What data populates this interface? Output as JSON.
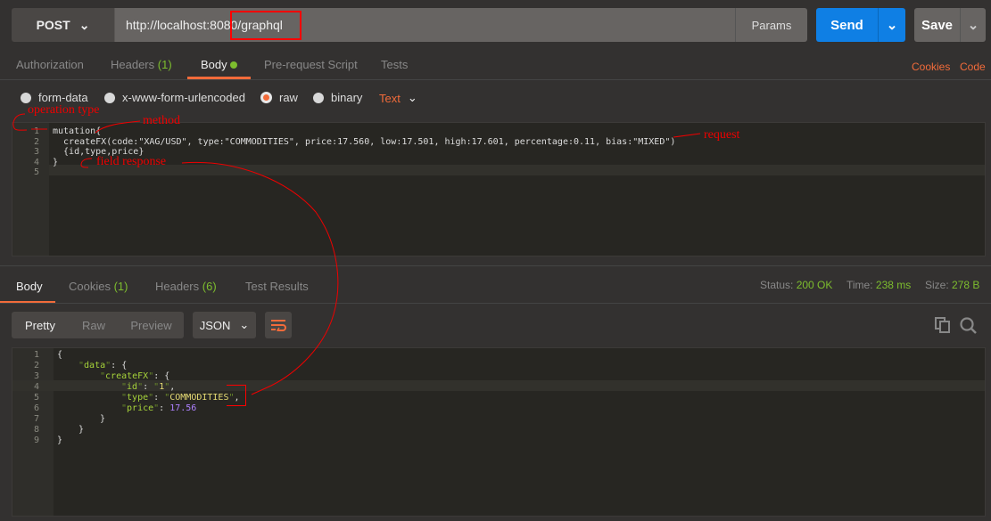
{
  "request": {
    "method": "POST",
    "url": "http://localhost:8080/graphql",
    "params_label": "Params",
    "send_label": "Send",
    "save_label": "Save"
  },
  "request_tabs": [
    {
      "label": "Authorization"
    },
    {
      "label": "Headers",
      "count": "(1)"
    },
    {
      "label": "Body"
    },
    {
      "label": "Pre-request Script"
    },
    {
      "label": "Tests"
    }
  ],
  "links": {
    "cookies": "Cookies",
    "code": "Code"
  },
  "body_modes": [
    "form-data",
    "x-www-form-urlencoded",
    "raw",
    "binary"
  ],
  "body_selected_mode": "raw",
  "content_type": "Text",
  "request_code": {
    "line_numbers": [
      "1",
      "2",
      "3",
      "4",
      "5"
    ],
    "lines": [
      "mutation{",
      "  createFX(code:\"XAG/USD\", type:\"COMMODITIES\", price:17.560, low:17.501, high:17.601, percentage:0.11, bias:\"MIXED\")",
      "  {id,type,price}",
      "}",
      ""
    ]
  },
  "annotations": {
    "operation_type": "operation  type",
    "method": "method",
    "request": "request",
    "field_response": "field  response"
  },
  "response_tabs": [
    {
      "label": "Body"
    },
    {
      "label": "Cookies",
      "count": "(1)"
    },
    {
      "label": "Headers",
      "count": "(6)"
    },
    {
      "label": "Test Results"
    }
  ],
  "response_meta": {
    "status_label": "Status:",
    "status": "200 OK",
    "time_label": "Time:",
    "time": "238 ms",
    "size_label": "Size:",
    "size": "278 B"
  },
  "view_modes": [
    "Pretty",
    "Raw",
    "Preview"
  ],
  "format": "JSON",
  "response_code": {
    "line_numbers": [
      "1",
      "2",
      "3",
      "4",
      "5",
      "6",
      "7",
      "8",
      "9"
    ],
    "tokens": {
      "open": "{",
      "data_key": "data",
      "createfx_key": "createFX",
      "id_key": "id",
      "id_val": "1",
      "type_key": "type",
      "type_val": "COMMODITIES",
      "price_key": "price",
      "price_val": "17.56",
      "close": "}",
      "colon": ": ",
      "comma": ",",
      "quote": "\""
    }
  },
  "colors": {
    "accent": "#f26b3a",
    "send": "#0f7fe4",
    "success": "#7dbd2e",
    "annotation": "#e00000"
  }
}
